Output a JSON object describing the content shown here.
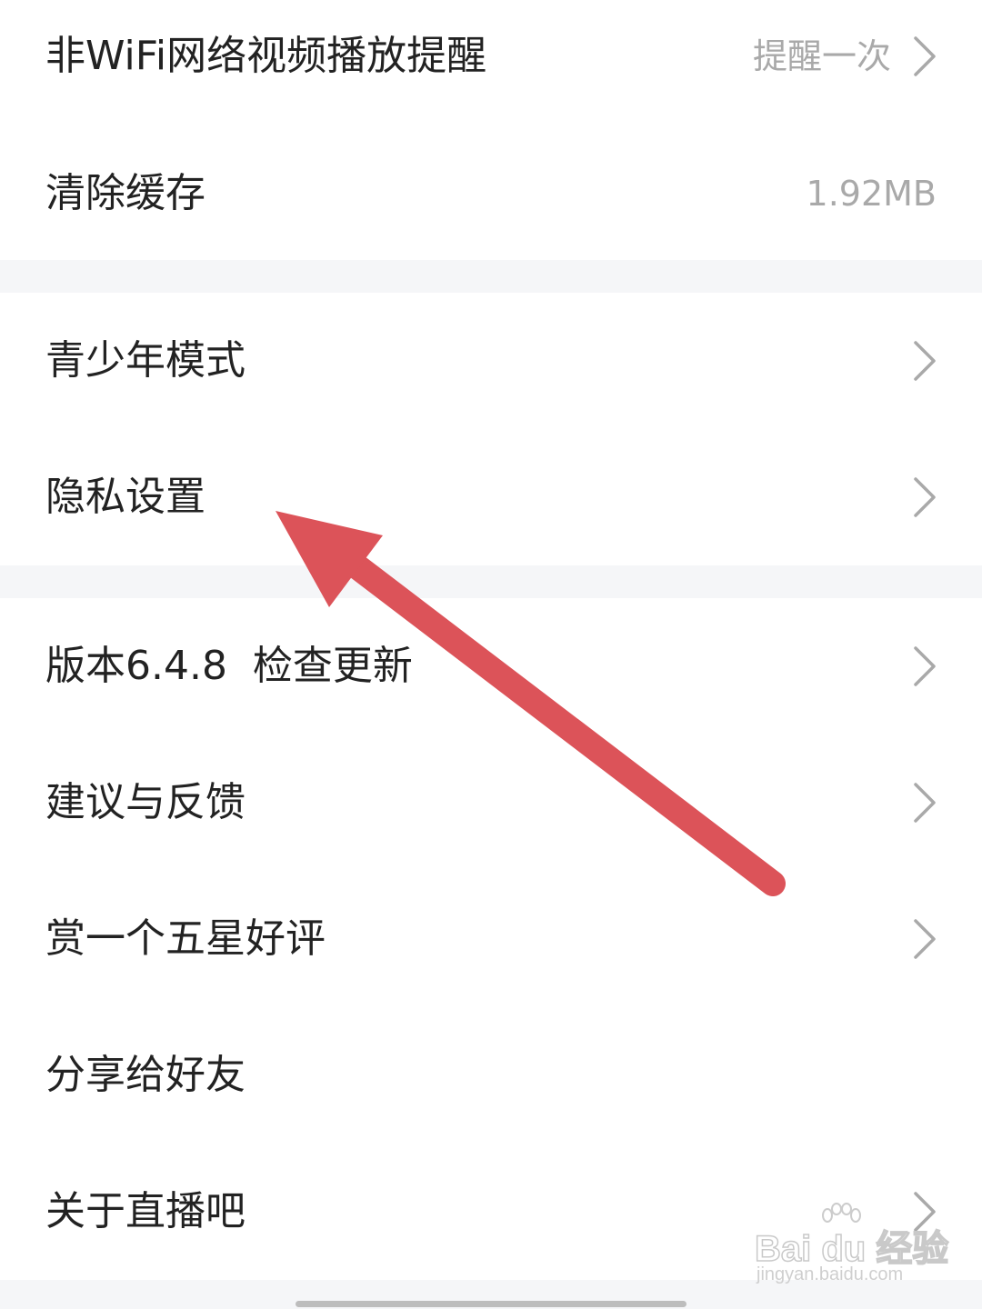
{
  "settings_list": {
    "items": [
      {
        "label": "非WiFi网络视频播放提醒",
        "value": "提醒一次"
      },
      {
        "label": "清除缓存",
        "value": "1.92MB"
      },
      {
        "label": "青少年模式"
      },
      {
        "label": "隐私设置"
      },
      {
        "label": "版本6.4.8  检查更新"
      },
      {
        "label": "建议与反馈"
      },
      {
        "label": "赏一个五星好评"
      },
      {
        "label": "分享给好友"
      },
      {
        "label": "关于直播吧"
      }
    ]
  },
  "annotation": {
    "arrow_color": "#dc5359",
    "points_to": "隐私设置"
  },
  "watermark": {
    "brand": "Bai du 经验",
    "url": "jingyan.baidu.com"
  },
  "icons": {
    "chevron": "chevron-right-icon"
  }
}
